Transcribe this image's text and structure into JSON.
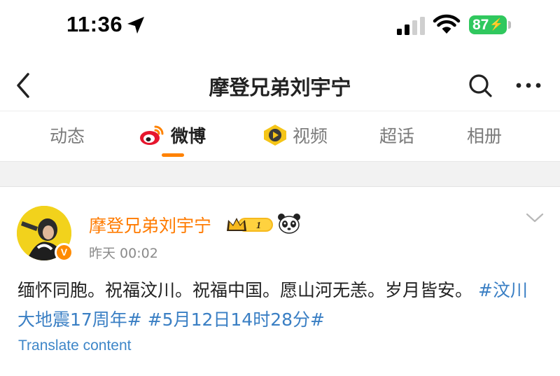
{
  "status_bar": {
    "time": "11:36",
    "battery": "87",
    "icons": [
      "location-arrow-icon",
      "signal-icon",
      "wifi-icon",
      "battery-icon"
    ]
  },
  "nav": {
    "title": "摩登兄弟刘宇宁",
    "icons": [
      "back-chevron-icon",
      "search-icon",
      "more-icon"
    ]
  },
  "tabs": [
    {
      "label": "动态"
    },
    {
      "label": "微博",
      "active": true,
      "icon": "weibo-logo-icon"
    },
    {
      "label": "视频",
      "icon": "video-play-icon"
    },
    {
      "label": "超话"
    },
    {
      "label": "相册"
    }
  ],
  "post": {
    "author": "摩登兄弟刘宇宁",
    "level_badge": "1",
    "time": "昨天 00:02",
    "text_plain": "缅怀同胞。祝福汶川。祝福中国。愿山河无恙。岁月皆安。",
    "hashtag_1": "#汶川大地震17周年#",
    "hashtag_2": "#5月12日14时28分#",
    "translate_label": "Translate content",
    "badges": [
      "verified-v-icon",
      "crown-badge-icon",
      "panda-icon"
    ]
  },
  "colors": {
    "accent": "#ff8200",
    "author_name": "#ff7b00",
    "link": "#3a7fc4",
    "battery": "#30c85e"
  }
}
